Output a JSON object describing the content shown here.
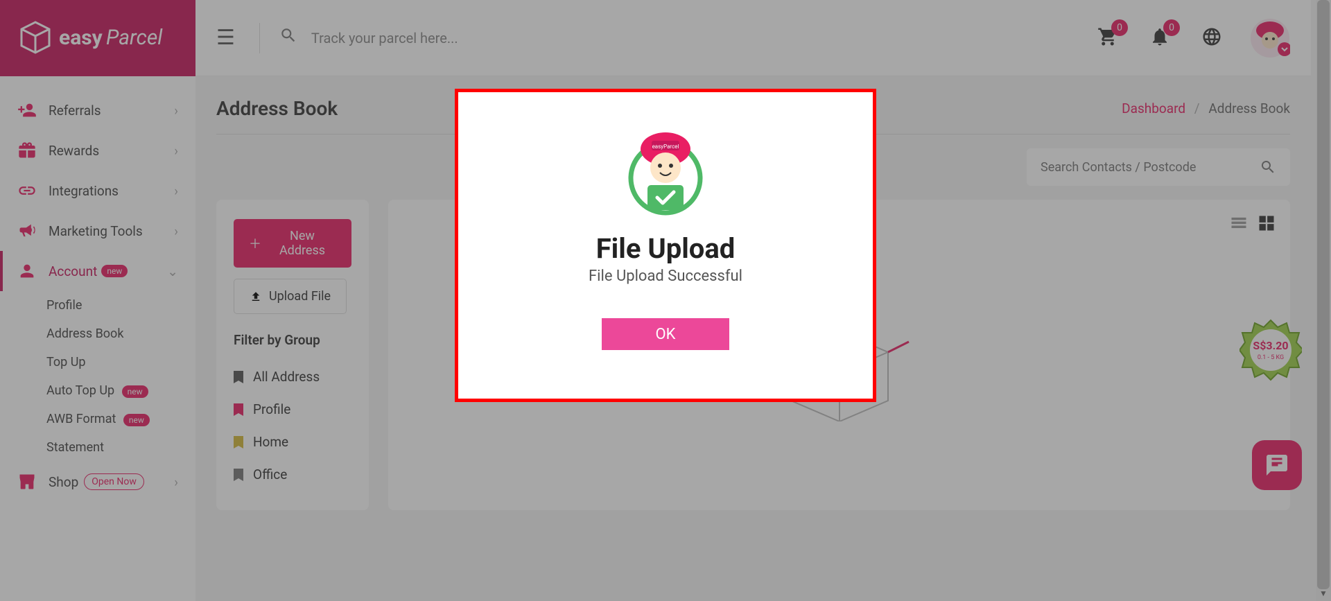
{
  "brand": {
    "name": "easyParcel"
  },
  "header": {
    "search_placeholder": "Track your parcel here...",
    "cart_count": "0",
    "notif_count": "0"
  },
  "sidebar": {
    "referrals": "Referrals",
    "rewards": "Rewards",
    "integrations": "Integrations",
    "marketing": "Marketing Tools",
    "account": "Account",
    "account_badge": "new",
    "profile": "Profile",
    "addressbook": "Address Book",
    "topup": "Top Up",
    "autotopup": "Auto Top Up",
    "autotopup_badge": "new",
    "awb": "AWB Format",
    "awb_badge": "new",
    "statement": "Statement",
    "shop": "Shop",
    "shop_badge": "Open Now"
  },
  "page": {
    "title": "Address Book",
    "bc_dashboard": "Dashboard",
    "bc_current": "Address Book",
    "search_placeholder": "Search Contacts / Postcode",
    "new_address": "New Address",
    "upload_file": "Upload File",
    "filter_title": "Filter by Group",
    "filters": {
      "all": "All Address",
      "profile": "Profile",
      "home": "Home",
      "office": "Office"
    }
  },
  "promo": {
    "price": "S$3.20",
    "sub": "0.1 - 5 KG"
  },
  "modal": {
    "title": "File Upload",
    "subtitle": "File Upload Successful",
    "ok": "OK"
  }
}
